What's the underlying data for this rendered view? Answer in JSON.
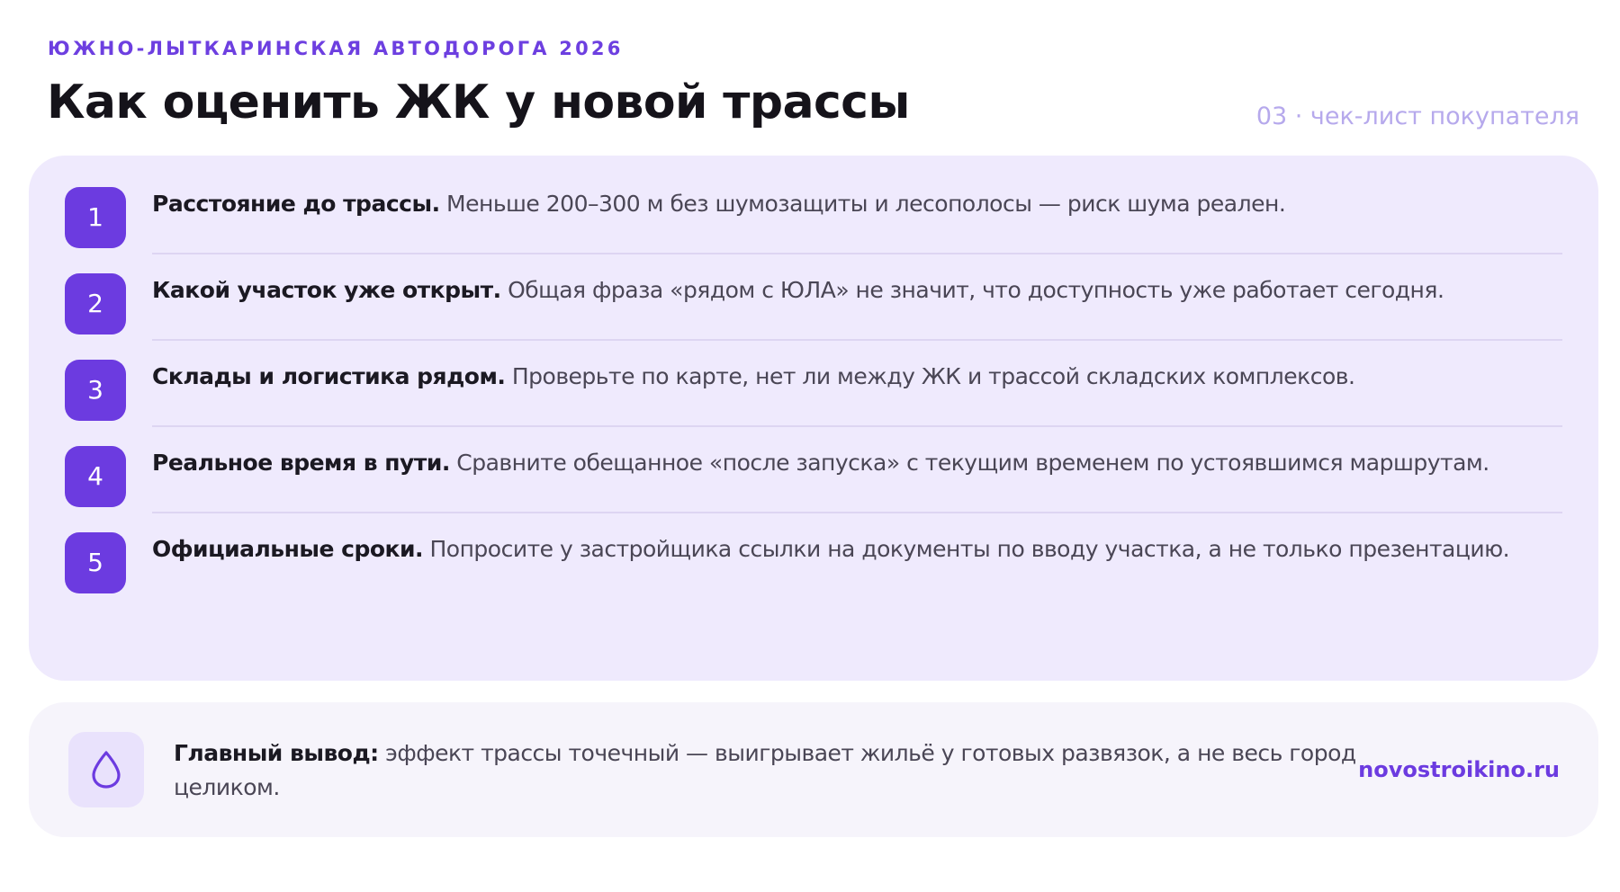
{
  "header": {
    "eyebrow": "ЮЖНО-ЛЫТКАРИНСКАЯ АВТОДОРОГА 2026",
    "title": "Как оценить ЖК у новой трассы",
    "tagline": "03 · чек-лист покупателя"
  },
  "checklist": {
    "items": [
      {
        "number": "1",
        "heading": "Расстояние до трассы.",
        "text": " Меньше 200–300 м без шумозащиты и лесополосы — риск шума реален."
      },
      {
        "number": "2",
        "heading": "Какой участок уже открыт.",
        "text": " Общая фраза «рядом с ЮЛА» не значит, что доступность уже работает сегодня."
      },
      {
        "number": "3",
        "heading": "Склады и логистика рядом.",
        "text": " Проверьте по карте, нет ли между ЖК и трассой складских комплексов."
      },
      {
        "number": "4",
        "heading": "Реальное время в пути.",
        "text": " Сравните обещанное «после запуска» с текущим временем по устоявшимся маршрутам."
      },
      {
        "number": "5",
        "heading": "Официальные сроки.",
        "text": " Попросите у застройщика ссылки на документы по вводу участка, а не только презентацию."
      }
    ]
  },
  "summary": {
    "icon": "drop-icon",
    "heading": "Главный вывод:",
    "text": " эффект трассы точечный — выигрывает жильё у готовых развязок, а не весь город целиком.",
    "site": "novostroikino.ru"
  },
  "colors": {
    "accent": "#6c3be0",
    "eyebrow": "#6d3fe0",
    "tagline": "#b6a9ec",
    "panel": "#efeafd",
    "summary_panel": "#f6f4fb",
    "icon_box": "#e9e2fc"
  }
}
